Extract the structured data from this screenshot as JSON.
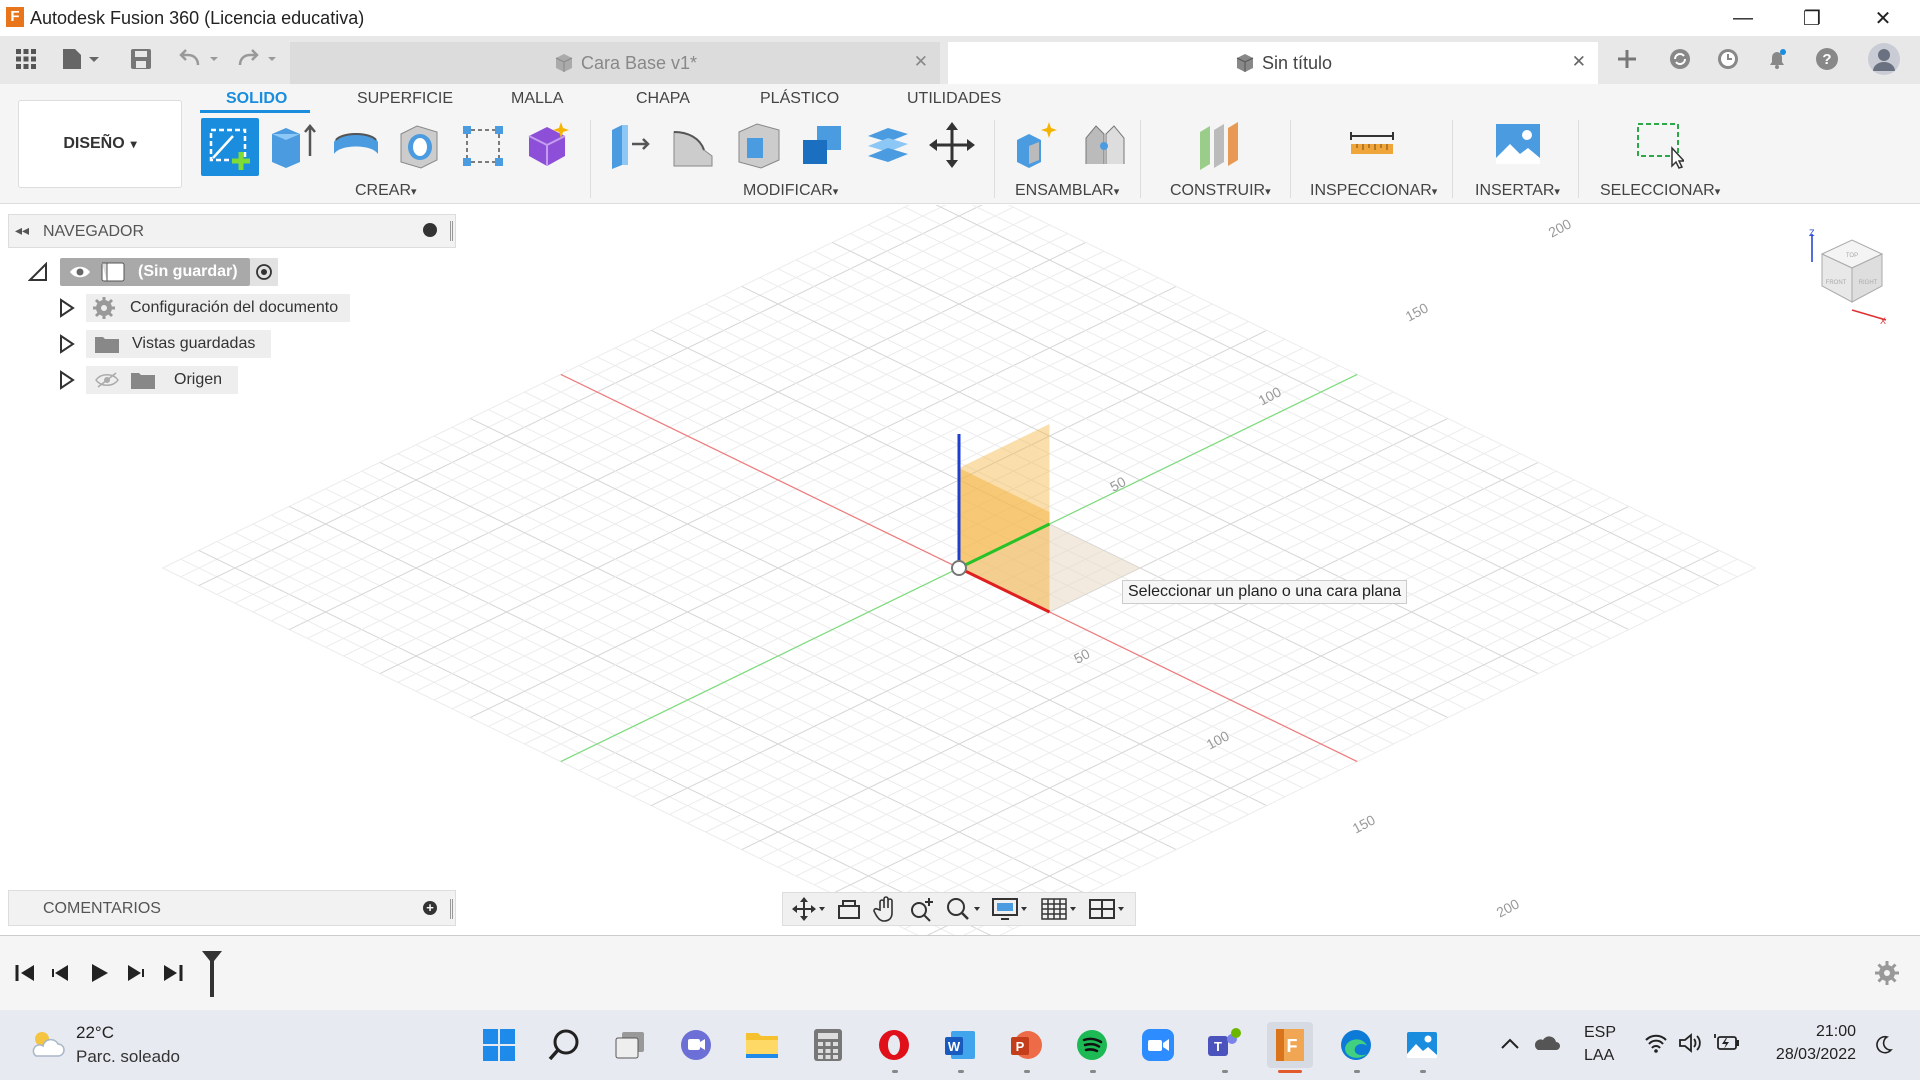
{
  "app": {
    "title": "Autodesk Fusion 360 (Licencia educativa)",
    "logo_letter": "F",
    "brand_color": "#e8751a",
    "accent_color": "#1a8dde",
    "window_controls": {
      "minimize": "—",
      "maximize": "❐",
      "close": "✕"
    }
  },
  "tabs": [
    {
      "label": "Cara Base v1*",
      "active": false,
      "close": "✕"
    },
    {
      "label": "Sin título",
      "active": true,
      "close": "✕"
    }
  ],
  "ribbon": {
    "workspace": "DISEÑO",
    "tabs": [
      "SOLIDO",
      "SUPERFICIE",
      "MALLA",
      "CHAPA",
      "PLÁSTICO",
      "UTILIDADES"
    ],
    "active_tab": "SOLIDO",
    "groups": [
      "CREAR",
      "MODIFICAR",
      "ENSAMBLAR",
      "CONSTRUIR",
      "INSPECCIONAR",
      "INSERTAR",
      "SELECCIONAR"
    ],
    "dropdown_caret": "▾"
  },
  "navigator": {
    "header": "NAVEGADOR",
    "root": "(Sin guardar)",
    "items": [
      "Configuración del documento",
      "Vistas guardadas",
      "Origen"
    ]
  },
  "comments": {
    "label": "COMENTARIOS"
  },
  "viewport": {
    "tooltip": "Seleccionar un plano o una cara plana",
    "grid_labels_x": [
      "50",
      "100",
      "150"
    ],
    "grid_labels_y": [
      "50",
      "100",
      "150",
      "200"
    ],
    "grid_label_200b": "200"
  },
  "viewcube": {
    "axis_z": "Z",
    "axis_x": "X",
    "front": "FRONT",
    "right": "RIGHT",
    "top": "TOP"
  },
  "taskbar": {
    "weather_temp": "22°C",
    "weather_desc": "Parc. soleado",
    "lang_top": "ESP",
    "lang_bottom": "LAA",
    "time": "21:00",
    "date": "28/03/2022"
  }
}
